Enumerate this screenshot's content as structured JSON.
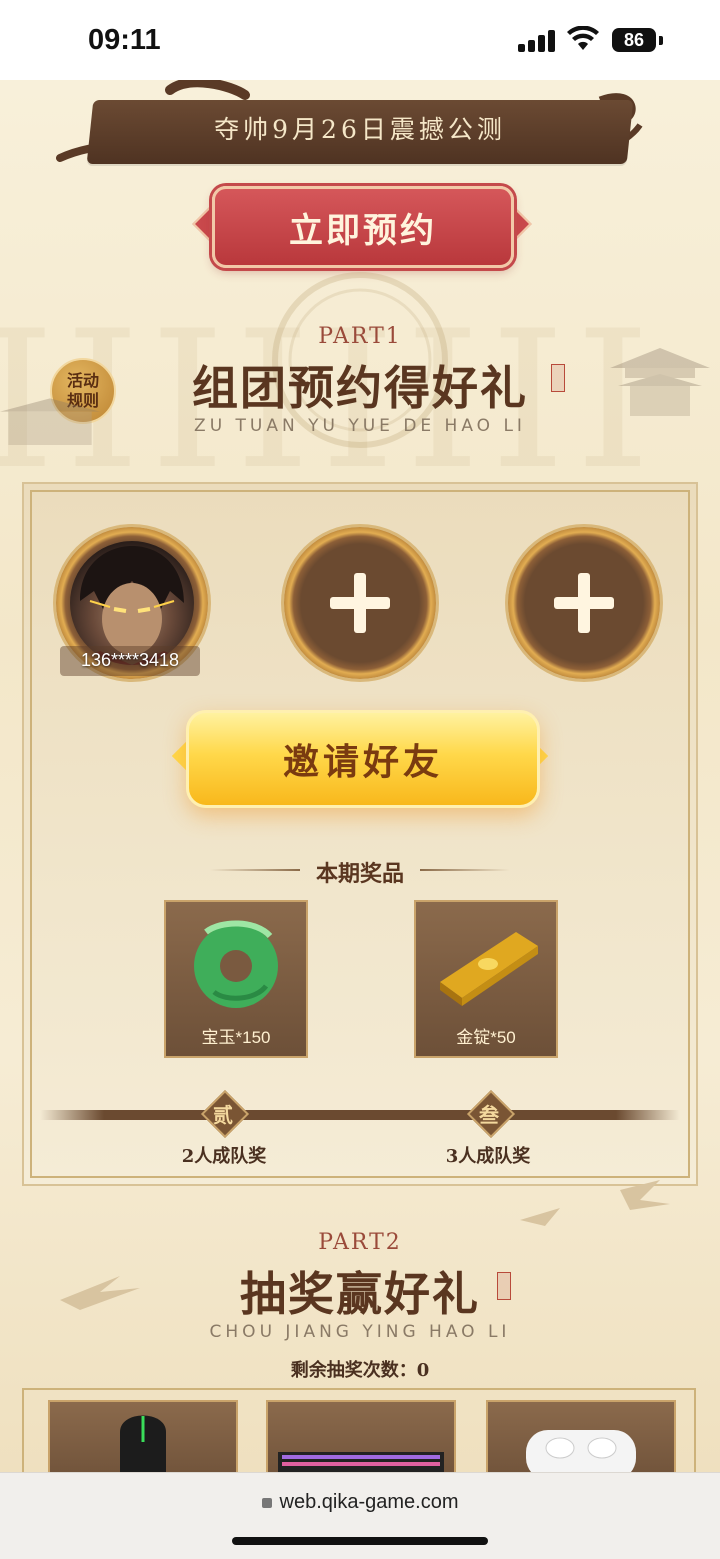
{
  "status_bar": {
    "time": "09:11",
    "battery": "86"
  },
  "header": {
    "banner": "夺帅9月26日震撼公测",
    "reserve_button": "立即预约"
  },
  "part1": {
    "label": "PART1",
    "title": "组团预约得好礼",
    "subtitle": "ZU TUAN YU YUE DE HAO LI",
    "rules_button": "活动\n规则",
    "rules_line1": "活动",
    "rules_line2": "规则",
    "team": {
      "member_phone": "136****3418",
      "invite_slots": 2
    },
    "invite_button": "邀请好友",
    "prizes_title": "本期奖品",
    "prizes": [
      {
        "name": "宝玉*150",
        "icon": "jade-icon"
      },
      {
        "name": "金锭*50",
        "icon": "gold-ingot-icon"
      }
    ],
    "tiers": [
      {
        "char": "贰",
        "label": "2人成队奖"
      },
      {
        "char": "叁",
        "label": "3人成队奖"
      }
    ]
  },
  "part2": {
    "label": "PART2",
    "title": "抽奖赢好礼",
    "subtitle": "CHOU JIANG YING HAO LI",
    "remaining_text": "剩余抽奖次数：0",
    "rewards": [
      {
        "icon": "gaming-mouse-icon"
      },
      {
        "icon": "keyboard-icon"
      },
      {
        "icon": "earbuds-icon"
      }
    ]
  },
  "browser": {
    "url": "web.qika-game.com"
  },
  "colors": {
    "accent_red": "#c4494b",
    "gold": "#ffd84a",
    "brown": "#5a3620"
  }
}
